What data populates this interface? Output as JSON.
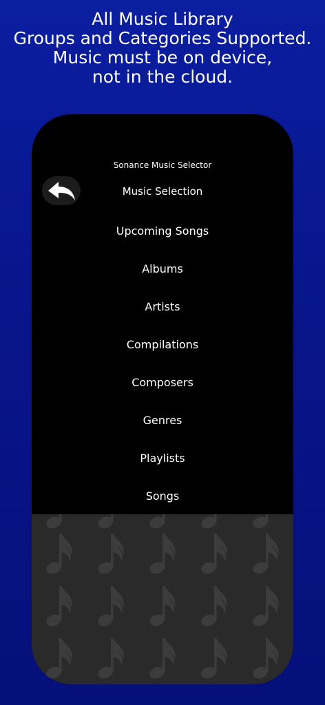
{
  "promo": {
    "lines": [
      "All Music Library",
      "Groups and Categories Supported.",
      "Music must be on device,",
      "not in the cloud."
    ]
  },
  "app": {
    "title": "Sonance Music Selector",
    "header": "Music Selection",
    "back_icon": "reply-arrow-icon",
    "menu": [
      "Upcoming Songs",
      "Albums",
      "Artists",
      "Compilations",
      "Composers",
      "Genres",
      "Playlists",
      "Songs"
    ],
    "background_icon": "music-note-icon"
  },
  "colors": {
    "background_top": "#0a1ea0",
    "background_bottom": "#06107a",
    "phone": "#000000",
    "pattern_bg": "#2a2a2a",
    "note": "#3c3c3c",
    "text": "#ffffff"
  }
}
